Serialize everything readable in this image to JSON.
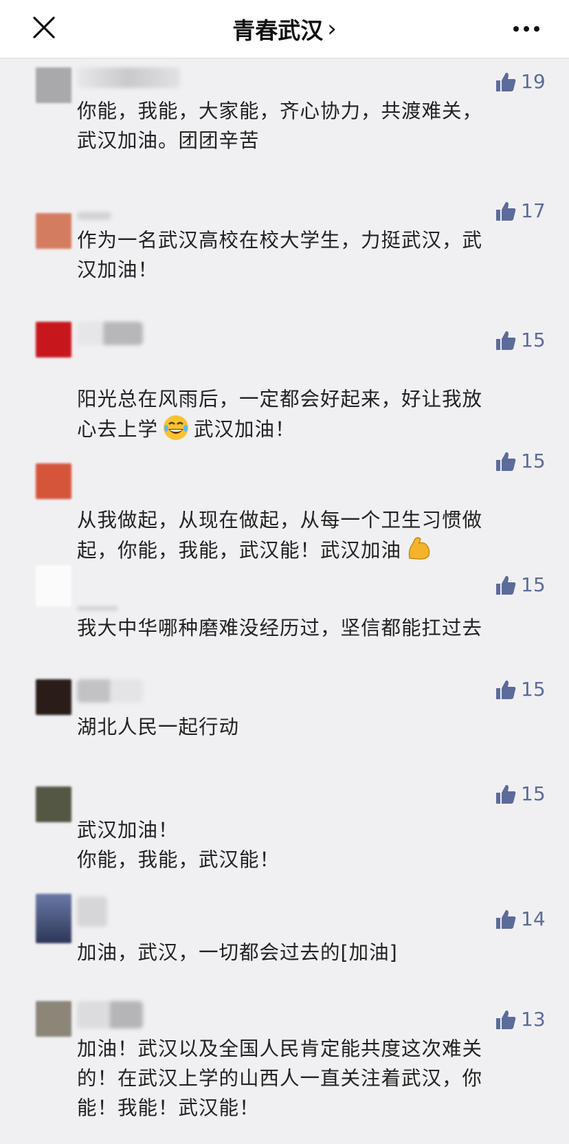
{
  "header": {
    "title": "青春武汉",
    "chevron": "›",
    "close_icon": "close-icon",
    "more_icon": "more-icon"
  },
  "comments": [
    {
      "likes": "19",
      "text": "你能，我能，大家能，齐心协力，共渡难关，\n武汉加油。团团辛苦"
    },
    {
      "likes": "17",
      "text": "作为一名武汉高校在校大学生，力挺武汉，武\n汉加油！"
    },
    {
      "likes": "15",
      "text_a": "阳光总在风雨后，一定都会好起来，好让我放\n心去上学",
      "emoji": "laughing-crying-emoji",
      "text_b": "武汉加油！"
    },
    {
      "likes": "15",
      "text_a": "从我做起，从现在做起，从每一个卫生习惯做\n起，你能，我能，武汉能！武汉加油",
      "emoji": "flexed-biceps-emoji"
    },
    {
      "likes": "15",
      "text": "我大中华哪种磨难没经历过，坚信都能扛过去"
    },
    {
      "likes": "15",
      "text": "湖北人民一起行动"
    },
    {
      "likes": "15",
      "text": "武汉加油！\n你能，我能，武汉能！"
    },
    {
      "likes": "14",
      "text": "加油，武汉，一切都会过去的[加油]"
    },
    {
      "likes": "13",
      "text": "加油！武汉以及全国人民肯定能共度这次难关\n的！在武汉上学的山西人一直关注着武汉，你\n能！我能！武汉能！"
    }
  ],
  "colors": {
    "background": "#f0f0f3",
    "like_color": "#5b6b9a",
    "header_bg": "#ffffff"
  }
}
